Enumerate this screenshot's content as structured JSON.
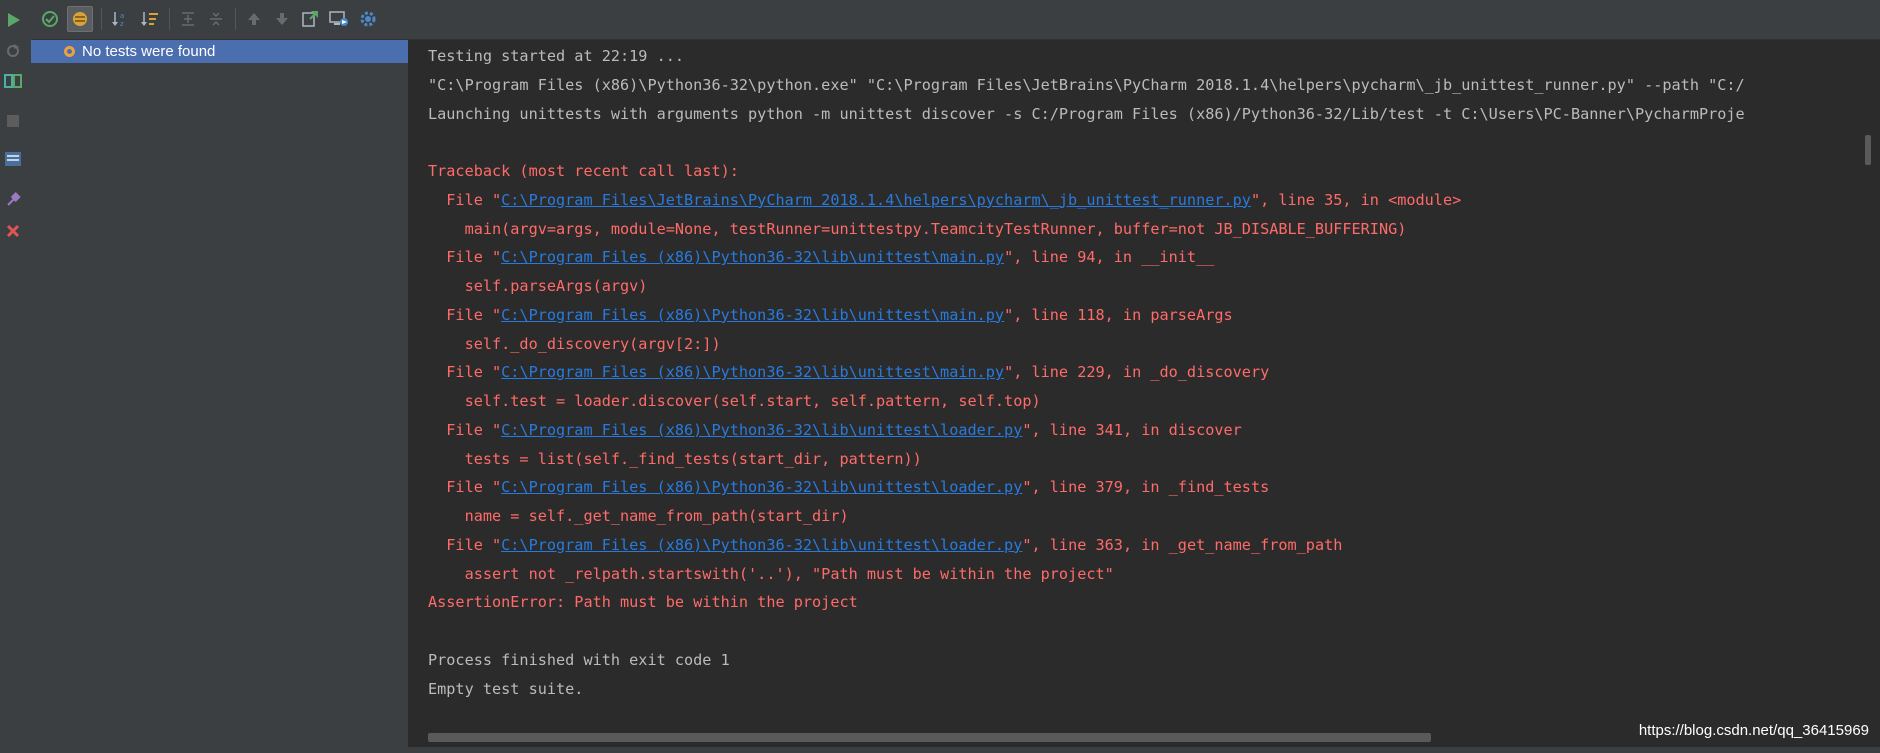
{
  "tree": {
    "status_item": "No tests were found"
  },
  "console": {
    "lines": [
      {
        "kind": "plain",
        "text": "Testing started at 22:19 ..."
      },
      {
        "kind": "plain",
        "text": "\"C:\\Program Files (x86)\\Python36-32\\python.exe\" \"C:\\Program Files\\JetBrains\\PyCharm 2018.1.4\\helpers\\pycharm\\_jb_unittest_runner.py\" --path \"C:/"
      },
      {
        "kind": "plain",
        "text": "Launching unittests with arguments python -m unittest discover -s C:/Program Files (x86)/Python36-32/Lib/test -t C:\\Users\\PC-Banner\\PycharmProje"
      },
      {
        "kind": "blank",
        "text": ""
      },
      {
        "kind": "err",
        "text": "Traceback (most recent call last):"
      },
      {
        "kind": "file",
        "prefix": "  File \"",
        "link": "C:\\Program Files\\JetBrains\\PyCharm 2018.1.4\\helpers\\pycharm\\_jb_unittest_runner.py",
        "suffix": "\", line 35, in <module>"
      },
      {
        "kind": "err",
        "text": "    main(argv=args, module=None, testRunner=unittestpy.TeamcityTestRunner, buffer=not JB_DISABLE_BUFFERING)"
      },
      {
        "kind": "file",
        "prefix": "  File \"",
        "link": "C:\\Program Files (x86)\\Python36-32\\lib\\unittest\\main.py",
        "suffix": "\", line 94, in __init__"
      },
      {
        "kind": "err",
        "text": "    self.parseArgs(argv)"
      },
      {
        "kind": "file",
        "prefix": "  File \"",
        "link": "C:\\Program Files (x86)\\Python36-32\\lib\\unittest\\main.py",
        "suffix": "\", line 118, in parseArgs"
      },
      {
        "kind": "err",
        "text": "    self._do_discovery(argv[2:])"
      },
      {
        "kind": "file",
        "prefix": "  File \"",
        "link": "C:\\Program Files (x86)\\Python36-32\\lib\\unittest\\main.py",
        "suffix": "\", line 229, in _do_discovery"
      },
      {
        "kind": "err",
        "text": "    self.test = loader.discover(self.start, self.pattern, self.top)"
      },
      {
        "kind": "file",
        "prefix": "  File \"",
        "link": "C:\\Program Files (x86)\\Python36-32\\lib\\unittest\\loader.py",
        "suffix": "\", line 341, in discover"
      },
      {
        "kind": "err",
        "text": "    tests = list(self._find_tests(start_dir, pattern))"
      },
      {
        "kind": "file",
        "prefix": "  File \"",
        "link": "C:\\Program Files (x86)\\Python36-32\\lib\\unittest\\loader.py",
        "suffix": "\", line 379, in _find_tests"
      },
      {
        "kind": "err",
        "text": "    name = self._get_name_from_path(start_dir)"
      },
      {
        "kind": "file",
        "prefix": "  File \"",
        "link": "C:\\Program Files (x86)\\Python36-32\\lib\\unittest\\loader.py",
        "suffix": "\", line 363, in _get_name_from_path"
      },
      {
        "kind": "err",
        "text": "    assert not _relpath.startswith('..'), \"Path must be within the project\""
      },
      {
        "kind": "err",
        "text": "AssertionError: Path must be within the project"
      },
      {
        "kind": "blank",
        "text": ""
      },
      {
        "kind": "plain",
        "text": "Process finished with exit code 1"
      },
      {
        "kind": "plain",
        "text": "Empty test suite."
      }
    ]
  },
  "watermark": "https://blog.csdn.net/qq_36415969",
  "icons": {
    "left": [
      "run-icon",
      "rerun-failed-icon",
      "toggle-auto-test-icon",
      "stop-icon",
      "export-icon",
      "pin-icon",
      "close-icon"
    ],
    "top": [
      "show-passed-icon",
      "show-ignored-icon",
      "sort-alphabetically-icon",
      "sort-by-duration-icon",
      "expand-all-icon",
      "collapse-all-icon",
      "previous-failed-icon",
      "next-failed-icon",
      "export-results-icon",
      "import-results-icon",
      "settings-icon"
    ]
  },
  "colors": {
    "console_bg": "#2b2b2b",
    "panel_bg": "#3c3f41",
    "selection": "#4b6eaf",
    "error_text": "#ff6b68",
    "plain_text": "#bbbbbb",
    "link_text": "#287bde"
  }
}
